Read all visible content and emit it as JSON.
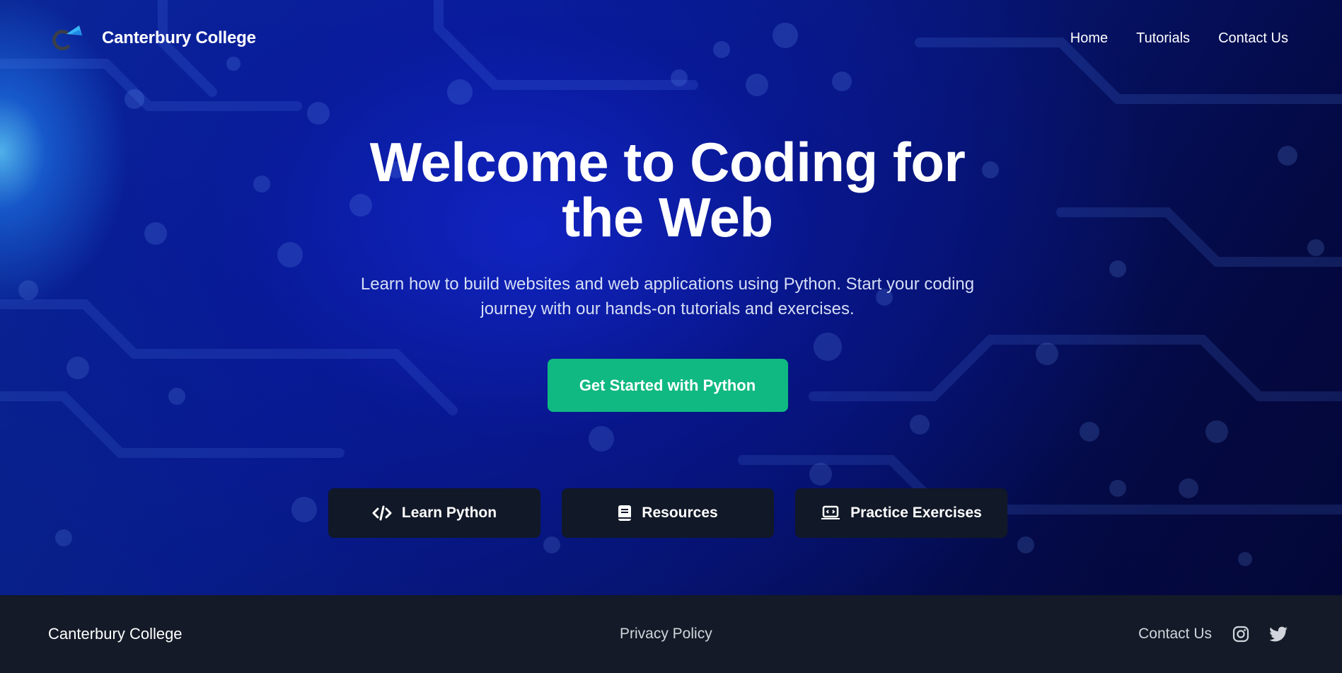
{
  "header": {
    "brand": "Canterbury College",
    "nav": [
      "Home",
      "Tutorials",
      "Contact Us"
    ]
  },
  "hero": {
    "title": "Welcome to Coding for the Web",
    "subtitle": "Learn how to build websites and web applications using Python. Start your coding journey with our hands-on tutorials and exercises.",
    "cta": "Get Started with Python"
  },
  "cards": [
    {
      "label": "Learn Python",
      "icon": "code-icon"
    },
    {
      "label": "Resources",
      "icon": "book-icon"
    },
    {
      "label": "Practice Exercises",
      "icon": "laptop-code-icon"
    }
  ],
  "footer": {
    "brand": "Canterbury College",
    "privacy": "Privacy Policy",
    "contact": "Contact Us",
    "social": [
      "instagram-icon",
      "twitter-icon"
    ]
  },
  "colors": {
    "accent": "#10b981",
    "card_bg": "#111827",
    "footer_bg": "#141a27",
    "hero_blue": "#0a1fb0"
  }
}
